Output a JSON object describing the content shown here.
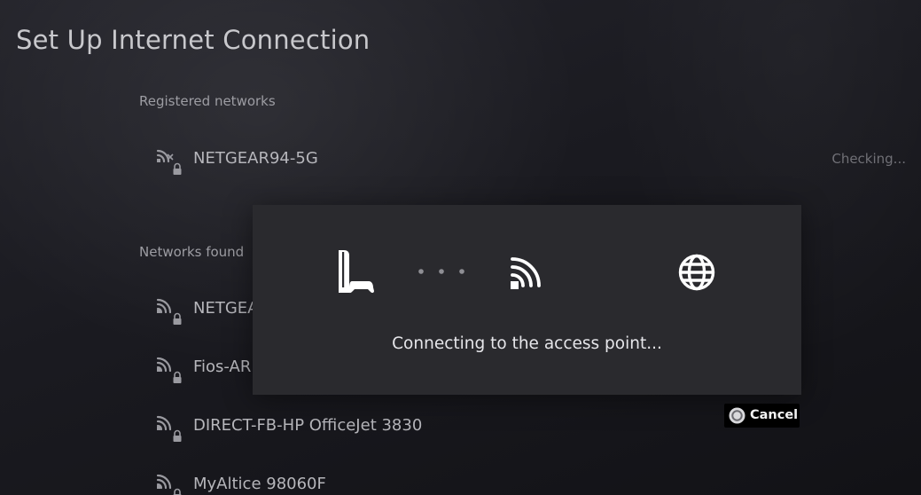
{
  "screen": {
    "title": "Set Up Internet Connection"
  },
  "registered": {
    "label": "Registered networks",
    "networks": [
      {
        "name": "NETGEAR94-5G",
        "status": "Checking...",
        "icon": "wifi-unavailable-locked-icon"
      }
    ]
  },
  "found": {
    "label": "Networks found",
    "networks": [
      {
        "name": "NETGEA",
        "icon": "wifi-locked-icon"
      },
      {
        "name": "Fios-AR",
        "icon": "wifi-locked-icon"
      },
      {
        "name": "DIRECT-FB-HP OfficeJet 3830",
        "icon": "wifi-locked-icon"
      },
      {
        "name": "MyAltice 98060F",
        "icon": "wifi-locked-icon"
      }
    ]
  },
  "dialog": {
    "message": "Connecting to the access point...",
    "steps": [
      "console-icon",
      "progress-dots",
      "access-point-icon",
      "internet-globe-icon"
    ]
  },
  "footer": {
    "cancel_label": "Cancel",
    "cancel_icon": "circle-button-icon"
  },
  "colors": {
    "background": "#1a1a20",
    "dialog": "#2a2a2e",
    "text_primary": "#e6e6ea",
    "text_secondary": "#9d9da3",
    "status": "#707076"
  }
}
